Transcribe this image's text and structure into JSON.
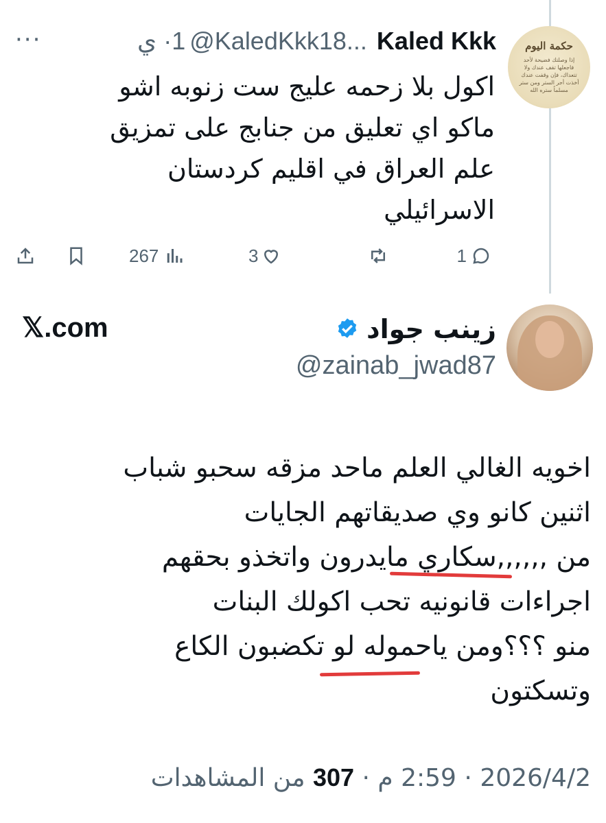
{
  "reply": {
    "author_name": "Kaled Kkk",
    "handle": "@KaledKkk18...",
    "time": "1· ي",
    "avatar_title": "حكمة اليوم",
    "avatar_text": "إذا وصلتك فضيحة لأحد فاجعلها تقف عندك ولا تتعداك، فإن وقفت عندك أخذت أجر الستر ومن ستر مسلماً ستره الله",
    "text": "اكول بلا زحمه عليج ست زنوبه اشو\nماكو اي تعليق من جنابج على تمزيق\nعلم العراق في اقليم كردستان\nالاسرائيلي",
    "actions": {
      "reply_count": "1",
      "retweet_count": "",
      "like_count": "3",
      "views_count": "267"
    }
  },
  "tweet": {
    "author_name": "زينب جواد",
    "handle": "@zainab_jwad87",
    "site": "𝕏.com",
    "text": "اخويه الغالي العلم ماحد مزقه سحبو شباب\nاثنين كانو وي صديقاتهم الجايات\nمن ,,,,,,سكاري مايدرون واتخذو بحقهم\nاجراءات قانونيه تحب اكولك البنات\nمنو ؟؟؟ومن ياحموله لو تكضبون الكاع\nوتسكتون",
    "date": "2026/4/2",
    "time": "2:59 م",
    "views": "307",
    "views_label": "من المشاهدات",
    "separator": "·"
  },
  "colors": {
    "verified": "#1d9bf0",
    "secondary_text": "#536471",
    "annotation_underline": "#e23b3b"
  }
}
